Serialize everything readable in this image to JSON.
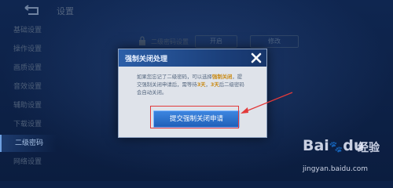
{
  "top": {
    "title": "设置"
  },
  "sidebar": {
    "items": [
      {
        "label": "基础设置"
      },
      {
        "label": "操作设置"
      },
      {
        "label": "画质设置"
      },
      {
        "label": "音效设置"
      },
      {
        "label": "辅助设置"
      },
      {
        "label": "下载设置"
      },
      {
        "label": "二级密码"
      },
      {
        "label": "网络设置"
      }
    ]
  },
  "background": {
    "section_label": "二级密码设置",
    "button_left": "开启",
    "button_right": "修改"
  },
  "dialog": {
    "title": "强制关闭处理",
    "close_icon": "close-icon",
    "body_1": "如果您忘记了二级密码，可以选择",
    "body_hl_1": "强制关闭",
    "body_2": "，提交强制关闭申请后，需等待",
    "body_hl_2": "3天",
    "body_3": "，",
    "body_hl_3": "3天",
    "body_4": "后二级密码会自动关闭。",
    "submit_label": "提交强制关闭申请"
  },
  "watermark": {
    "logo": "Bai",
    "logo_mid": "du",
    "cn": "经验",
    "url": "jingyan.baidu.com"
  },
  "colors": {
    "accent": "#2f6fc9",
    "highlight": "#c98a14",
    "annotation": "#e23a3a"
  }
}
